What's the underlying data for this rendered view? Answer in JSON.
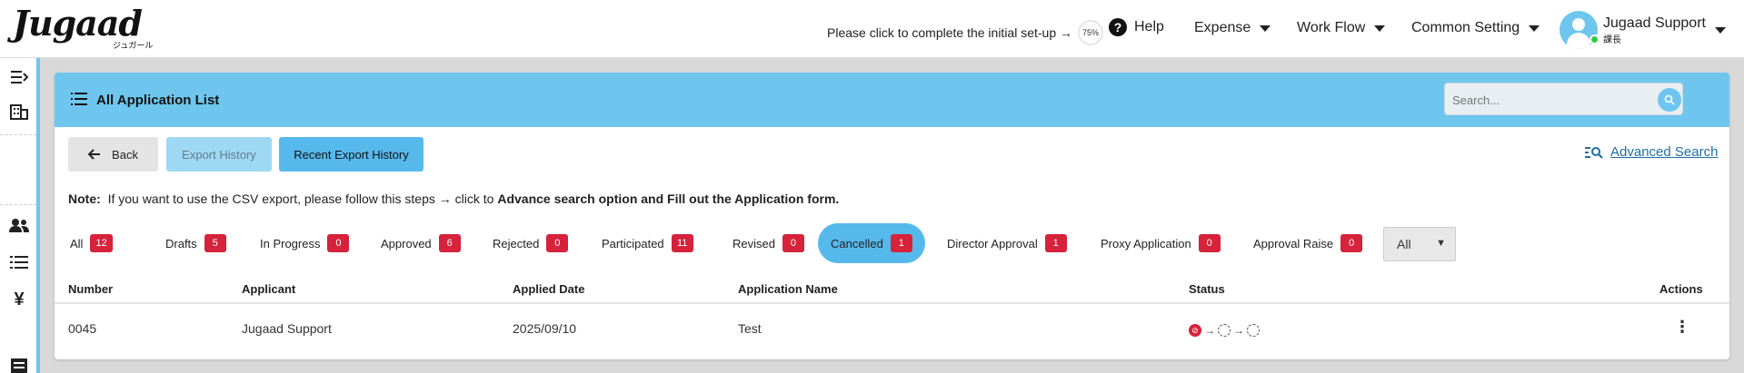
{
  "brand": {
    "name": "Jugaad",
    "sub": "ジュガール"
  },
  "header": {
    "setup_text": "Please click to complete the initial set-up →",
    "setup_progress": "75%",
    "help": "Help",
    "menus": [
      "Expense",
      "Work Flow",
      "Common Setting"
    ],
    "user_name": "Jugaad Support",
    "user_role": "課長"
  },
  "page": {
    "title": "All Application List",
    "search_placeholder": "Search..."
  },
  "buttons": {
    "back": "Back",
    "export_history": "Export History",
    "recent_export_history": "Recent Export History",
    "advanced_search": "Advanced Search"
  },
  "note": {
    "label": "Note:",
    "text": "If you want to use the CSV export, please follow this steps → click to",
    "emphasis": "Advance search option and Fill out the Application form."
  },
  "tabs": [
    {
      "label": "All",
      "count": "12"
    },
    {
      "label": "Drafts",
      "count": "5"
    },
    {
      "label": "In Progress",
      "count": "0"
    },
    {
      "label": "Approved",
      "count": "6"
    },
    {
      "label": "Rejected",
      "count": "0"
    },
    {
      "label": "Participated",
      "count": "11"
    },
    {
      "label": "Revised",
      "count": "0"
    },
    {
      "label": "Cancelled",
      "count": "1"
    },
    {
      "label": "Director Approval",
      "count": "1"
    },
    {
      "label": "Proxy Application",
      "count": "0"
    },
    {
      "label": "Approval Raise",
      "count": "0"
    }
  ],
  "filter_select": {
    "selected": "All"
  },
  "table": {
    "columns": [
      "Number",
      "Applicant",
      "Applied Date",
      "Application Name",
      "Status",
      "Actions"
    ],
    "rows": [
      {
        "number": "0045",
        "applicant": "Jugaad Support",
        "applied_date": "2025/09/10",
        "application_name": "Test"
      }
    ]
  },
  "colors": {
    "accent": "#6ec6ef",
    "button_blue": "#56b9ec",
    "badge_red": "#d6223b",
    "link": "#1f6fa3"
  }
}
